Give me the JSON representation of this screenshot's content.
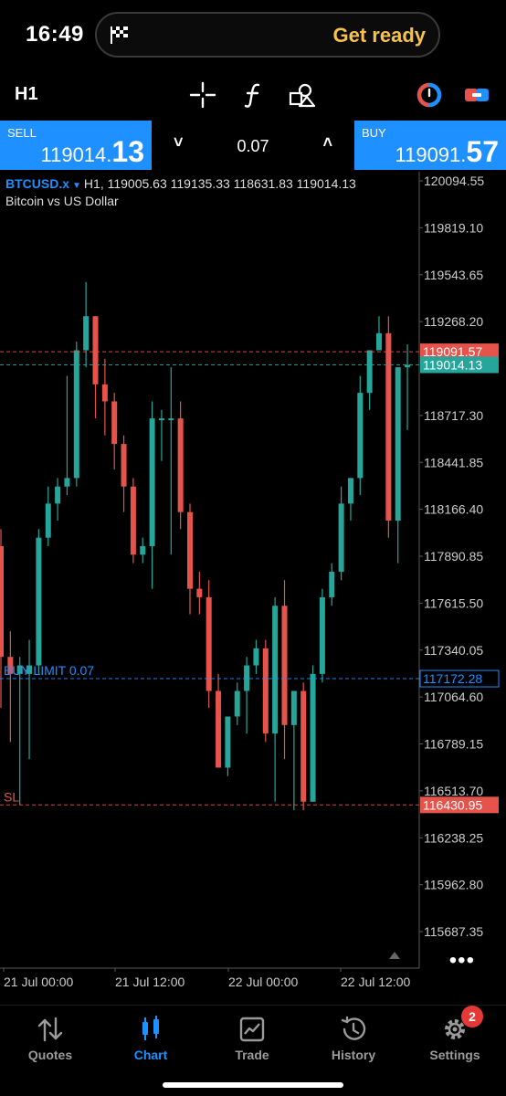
{
  "status": {
    "time": "16:49",
    "banner": "Get ready"
  },
  "toolbar": {
    "timeframe": "H1",
    "icons": [
      "crosshair-icon",
      "indicators-icon",
      "objects-icon",
      "one-click-trading-icon",
      "account-toggle-icon"
    ]
  },
  "trade": {
    "sell_label": "SELL",
    "sell_price_small": "119014.",
    "sell_price_big": "13",
    "buy_label": "BUY",
    "buy_price_small": "119091.",
    "buy_price_big": "57",
    "lot": "0.07",
    "down": "˅",
    "up": "˄"
  },
  "chart_header": {
    "symbol": "BTCUSD.x",
    "caret": "▼",
    "ohlc": "H1, 119005.63 119135.33 118631.83 119014.13",
    "description": "Bitcoin vs US Dollar"
  },
  "chart_data": {
    "type": "candlestick",
    "symbol": "BTCUSD.x",
    "timeframe": "H1",
    "ylim": [
      115550,
      120150
    ],
    "y_ticks": [
      "120094.55",
      "119819.10",
      "119543.65",
      "119268.20",
      "118717.30",
      "118441.85",
      "118166.40",
      "117890.85",
      "117615.50",
      "117340.05",
      "117064.60",
      "116789.15",
      "116513.70",
      "116238.25",
      "115962.80",
      "115687.35"
    ],
    "x_ticks": [
      "21 Jul 00:00",
      "21 Jul 12:00",
      "22 Jul 00:00",
      "22 Jul 12:00"
    ],
    "lines": [
      {
        "label": "119091.57",
        "value": 119091.57,
        "color": "#e5534b",
        "kind": "ask"
      },
      {
        "label": "119014.13",
        "value": 119014.13,
        "color": "#26a69a",
        "kind": "bid"
      },
      {
        "label": "117172.28",
        "value": 117172.28,
        "color": "#1e90ff",
        "kind": "order",
        "text": "BUY LIMIT 0.07"
      },
      {
        "label": "116430.95",
        "value": 116430.95,
        "color": "#e5534b",
        "kind": "sl",
        "text": "SL"
      }
    ],
    "candles": [
      {
        "o": 117950,
        "h": 118050,
        "l": 117000,
        "c": 117300
      },
      {
        "o": 117300,
        "h": 117450,
        "l": 116800,
        "c": 117200
      },
      {
        "o": 117200,
        "h": 117300,
        "l": 116430,
        "c": 117250
      },
      {
        "o": 117200,
        "h": 117400,
        "l": 116700,
        "c": 117250
      },
      {
        "o": 117250,
        "h": 118050,
        "l": 117200,
        "c": 118000
      },
      {
        "o": 118000,
        "h": 118300,
        "l": 117950,
        "c": 118200
      },
      {
        "o": 118200,
        "h": 118350,
        "l": 118100,
        "c": 118300
      },
      {
        "o": 118300,
        "h": 118950,
        "l": 118250,
        "c": 118350
      },
      {
        "o": 118350,
        "h": 119150,
        "l": 118300,
        "c": 119100
      },
      {
        "o": 119100,
        "h": 119500,
        "l": 119000,
        "c": 119300
      },
      {
        "o": 119300,
        "h": 119300,
        "l": 118700,
        "c": 118900
      },
      {
        "o": 118900,
        "h": 119050,
        "l": 118600,
        "c": 118800
      },
      {
        "o": 118800,
        "h": 118850,
        "l": 118400,
        "c": 118550
      },
      {
        "o": 118550,
        "h": 118600,
        "l": 118150,
        "c": 118300
      },
      {
        "o": 118300,
        "h": 118350,
        "l": 117850,
        "c": 117900
      },
      {
        "o": 117900,
        "h": 118000,
        "l": 117850,
        "c": 117950
      },
      {
        "o": 117950,
        "h": 118800,
        "l": 117700,
        "c": 118700
      },
      {
        "o": 118700,
        "h": 118750,
        "l": 118450,
        "c": 118700
      },
      {
        "o": 118700,
        "h": 119000,
        "l": 117900,
        "c": 118700
      },
      {
        "o": 118700,
        "h": 118800,
        "l": 118050,
        "c": 118150
      },
      {
        "o": 118150,
        "h": 118200,
        "l": 117550,
        "c": 117700
      },
      {
        "o": 117700,
        "h": 117800,
        "l": 117550,
        "c": 117650
      },
      {
        "o": 117650,
        "h": 117750,
        "l": 117000,
        "c": 117100
      },
      {
        "o": 117100,
        "h": 117200,
        "l": 116700,
        "c": 116650
      },
      {
        "o": 116650,
        "h": 116850,
        "l": 116600,
        "c": 116950
      },
      {
        "o": 116950,
        "h": 117150,
        "l": 116900,
        "c": 117100
      },
      {
        "o": 117100,
        "h": 117300,
        "l": 116850,
        "c": 117250
      },
      {
        "o": 117250,
        "h": 117400,
        "l": 117200,
        "c": 117350
      },
      {
        "o": 117350,
        "h": 117400,
        "l": 116800,
        "c": 116850
      },
      {
        "o": 116850,
        "h": 117650,
        "l": 116450,
        "c": 117600
      },
      {
        "o": 117600,
        "h": 117750,
        "l": 116700,
        "c": 116900
      },
      {
        "o": 116900,
        "h": 117100,
        "l": 116400,
        "c": 117100
      },
      {
        "o": 117100,
        "h": 117150,
        "l": 116400,
        "c": 116450
      },
      {
        "o": 116450,
        "h": 117250,
        "l": 116450,
        "c": 117200
      },
      {
        "o": 117200,
        "h": 117700,
        "l": 117150,
        "c": 117650
      },
      {
        "o": 117650,
        "h": 117850,
        "l": 117600,
        "c": 117800
      },
      {
        "o": 117800,
        "h": 118300,
        "l": 117750,
        "c": 118200
      },
      {
        "o": 118200,
        "h": 118250,
        "l": 118100,
        "c": 118350
      },
      {
        "o": 118350,
        "h": 118950,
        "l": 118250,
        "c": 118850
      },
      {
        "o": 118850,
        "h": 119050,
        "l": 118750,
        "c": 119100
      },
      {
        "o": 119100,
        "h": 119300,
        "l": 119100,
        "c": 119200
      },
      {
        "o": 119200,
        "h": 119300,
        "l": 118000,
        "c": 118100
      },
      {
        "o": 118100,
        "h": 119000,
        "l": 117850,
        "c": 119000
      },
      {
        "o": 119000,
        "h": 119135,
        "l": 118632,
        "c": 119014
      }
    ]
  },
  "overlay": {
    "more": "•••"
  },
  "tabs": [
    {
      "label": "Quotes",
      "icon": "quotes-icon"
    },
    {
      "label": "Chart",
      "icon": "chart-icon"
    },
    {
      "label": "Trade",
      "icon": "trade-icon"
    },
    {
      "label": "History",
      "icon": "history-icon"
    },
    {
      "label": "Settings",
      "icon": "settings-icon"
    }
  ],
  "settings_badge": "2",
  "colors": {
    "accent": "#1e90ff",
    "bull": "#26a69a",
    "bear": "#e5534b",
    "ready": "#f6c24a"
  }
}
